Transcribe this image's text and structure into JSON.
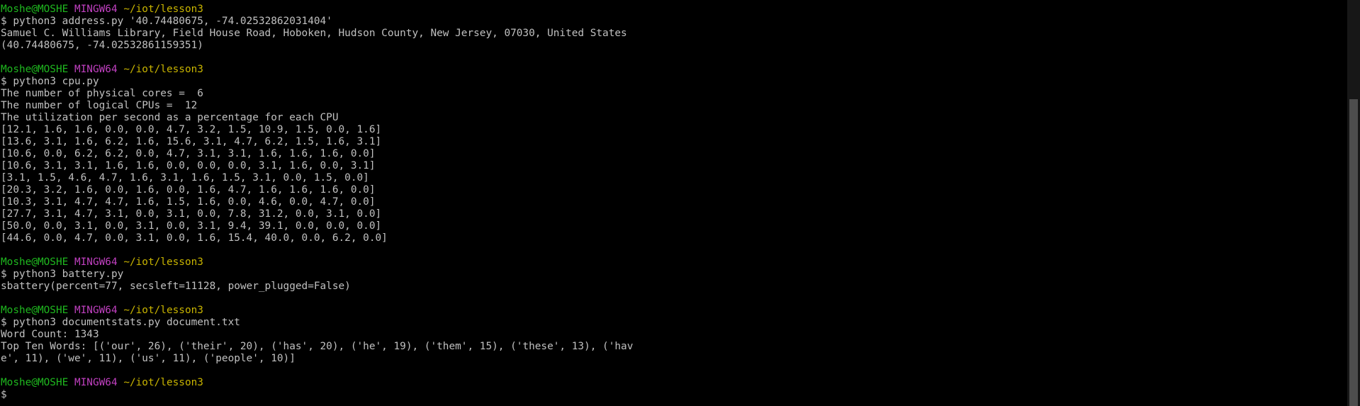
{
  "prompt": {
    "user": "Moshe@MOSHE",
    "env": "MINGW64",
    "path": "~/iot/lesson3",
    "symbol": "$"
  },
  "sessions": [
    {
      "command": "python3 address.py '40.74480675, -74.02532862031404'",
      "output": [
        "Samuel C. Williams Library, Field House Road, Hoboken, Hudson County, New Jersey, 07030, United States",
        "(40.74480675, -74.02532861159351)"
      ]
    },
    {
      "command": "python3 cpu.py",
      "output": [
        "The number of physical cores =  6",
        "The number of logical CPUs =  12",
        "The utilization per second as a percentage for each CPU",
        "[12.1, 1.6, 1.6, 0.0, 0.0, 4.7, 3.2, 1.5, 10.9, 1.5, 0.0, 1.6]",
        "[13.6, 3.1, 1.6, 6.2, 1.6, 15.6, 3.1, 4.7, 6.2, 1.5, 1.6, 3.1]",
        "[10.6, 0.0, 6.2, 6.2, 0.0, 4.7, 3.1, 3.1, 1.6, 1.6, 1.6, 0.0]",
        "[10.6, 3.1, 3.1, 1.6, 1.6, 0.0, 0.0, 0.0, 3.1, 1.6, 0.0, 3.1]",
        "[3.1, 1.5, 4.6, 4.7, 1.6, 3.1, 1.6, 1.5, 3.1, 0.0, 1.5, 0.0]",
        "[20.3, 3.2, 1.6, 0.0, 1.6, 0.0, 1.6, 4.7, 1.6, 1.6, 1.6, 0.0]",
        "[10.3, 3.1, 4.7, 4.7, 1.6, 1.5, 1.6, 0.0, 4.6, 0.0, 4.7, 0.0]",
        "[27.7, 3.1, 4.7, 3.1, 0.0, 3.1, 0.0, 7.8, 31.2, 0.0, 3.1, 0.0]",
        "[50.0, 0.0, 3.1, 0.0, 3.1, 0.0, 3.1, 9.4, 39.1, 0.0, 0.0, 0.0]",
        "[44.6, 0.0, 4.7, 0.0, 3.1, 0.0, 1.6, 15.4, 40.0, 0.0, 6.2, 0.0]"
      ]
    },
    {
      "command": "python3 battery.py",
      "output": [
        "sbattery(percent=77, secsleft=11128, power_plugged=False)"
      ]
    },
    {
      "command": "python3 documentstats.py document.txt",
      "output": [
        "Word Count: 1343",
        "Top Ten Words: [('our', 26), ('their', 20), ('has', 20), ('he', 19), ('them', 15), ('these', 13), ('hav",
        "e', 11), ('we', 11), ('us', 11), ('people', 10)]"
      ]
    }
  ],
  "final_prompt_input": "",
  "colors": {
    "background": "#000000",
    "text": "#c0c0c0",
    "user": "#1fb81f",
    "host": "#c040c0",
    "path": "#c8b400"
  }
}
